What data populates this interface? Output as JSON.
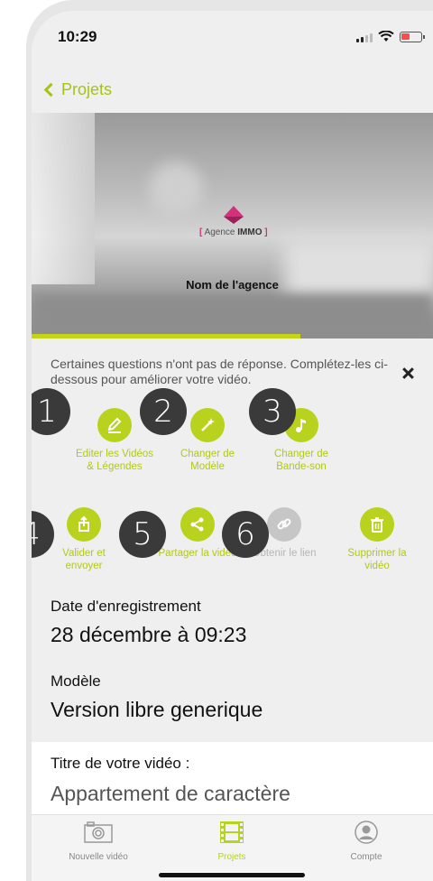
{
  "status": {
    "time": "10:29"
  },
  "nav": {
    "back_label": "Projets"
  },
  "video": {
    "logo_text_prefix": "[",
    "logo_text_agence": "Agence",
    "logo_text_immo": "IMMO",
    "logo_text_suffix": "]",
    "agency_name": "Nom de l'agence",
    "progress_fraction": 0.67
  },
  "message": "Certaines questions n'ont pas de réponse. Complétez-les ci-dessous pour améliorer votre vidéo.",
  "actions": [
    {
      "label": "Editer les Vidéos & Légendes",
      "icon": "pencil-icon",
      "badge": "1",
      "enabled": true
    },
    {
      "label": "Changer de Modèle",
      "icon": "magic-wand-icon",
      "badge": "2",
      "enabled": true
    },
    {
      "label": "Changer de Bande-son",
      "icon": "music-note-icon",
      "badge": "3",
      "enabled": true
    },
    {
      "label": "Valider et envoyer",
      "icon": "upload-icon",
      "badge": "4",
      "enabled": true
    },
    {
      "label": "Partager la vidéo",
      "icon": "share-icon",
      "badge": "5",
      "enabled": true
    },
    {
      "label": "Obtenir le lien",
      "icon": "link-icon",
      "badge": "6",
      "enabled": false
    },
    {
      "label": "Supprimer la vidéo",
      "icon": "trash-icon",
      "badge": "",
      "enabled": true
    }
  ],
  "details": {
    "date_label": "Date d'enregistrement",
    "date_value": "28 décembre à 09:23",
    "model_label": "Modèle",
    "model_value": "Version libre generique"
  },
  "title_field": {
    "label": "Titre de votre vidéo :",
    "value": "Appartement de caractère"
  },
  "tabs": [
    {
      "label": "Nouvelle vidéo",
      "icon": "camera-icon",
      "active": false
    },
    {
      "label": "Projets",
      "icon": "film-icon",
      "active": true
    },
    {
      "label": "Compte",
      "icon": "user-icon",
      "active": false
    }
  ],
  "colors": {
    "accent": "#b9d21e",
    "brand": "#d4317a",
    "badge": "#3a3a3a"
  }
}
